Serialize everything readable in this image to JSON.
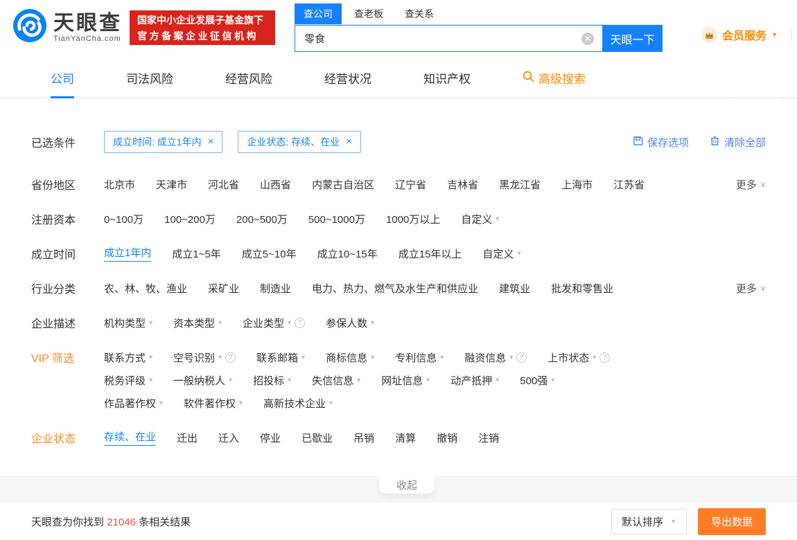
{
  "brand": {
    "name": "天眼查",
    "domain": "TianYanCha.com",
    "badge_line1": "国家中小企业发展子基金旗下",
    "badge_line2": "官方备案企业征信机构"
  },
  "colors": {
    "primary_blue": "#1681fd",
    "link_blue": "#4a87e9",
    "orange": "#ff8a2b",
    "badge_red": "#d9241b",
    "count_red": "#f34c3f",
    "export_orange": "#ff7d27"
  },
  "search": {
    "tabs": [
      {
        "label": "查公司",
        "active": true
      },
      {
        "label": "查老板",
        "active": false
      },
      {
        "label": "查关系",
        "active": false
      }
    ],
    "value": "零食",
    "button_label": "天眼一下"
  },
  "member": {
    "label": "会员服务"
  },
  "nav": {
    "items": [
      {
        "label": "公司",
        "active": true
      },
      {
        "label": "司法风险",
        "active": false
      },
      {
        "label": "经营风险",
        "active": false
      },
      {
        "label": "经营状况",
        "active": false
      },
      {
        "label": "知识产权",
        "active": false
      }
    ],
    "advanced_label": "高级搜索"
  },
  "selected_bar": {
    "label": "已选条件",
    "chips": [
      "成立时间: 成立1年内",
      "企业状态: 存续、在业"
    ],
    "save_label": "保存选项",
    "clear_label": "清除全部"
  },
  "filter_rows": [
    {
      "label": "省份地区",
      "more": "更多",
      "lines": [
        [
          {
            "text": "北京市"
          },
          {
            "text": "天津市"
          },
          {
            "text": "河北省"
          },
          {
            "text": "山西省"
          },
          {
            "text": "内蒙古自治区"
          },
          {
            "text": "辽宁省"
          },
          {
            "text": "吉林省"
          },
          {
            "text": "黑龙江省"
          },
          {
            "text": "上海市"
          },
          {
            "text": "江苏省"
          }
        ]
      ]
    },
    {
      "label": "注册资本",
      "lines": [
        [
          {
            "text": "0~100万"
          },
          {
            "text": "100~200万"
          },
          {
            "text": "200~500万"
          },
          {
            "text": "500~1000万"
          },
          {
            "text": "1000万以上"
          },
          {
            "text": "自定义",
            "arrow": true
          }
        ]
      ]
    },
    {
      "label": "成立时间",
      "lines": [
        [
          {
            "text": "成立1年内",
            "selected": true
          },
          {
            "text": "成立1~5年"
          },
          {
            "text": "成立5~10年"
          },
          {
            "text": "成立10~15年"
          },
          {
            "text": "成立15年以上"
          },
          {
            "text": "自定义",
            "arrow": true
          }
        ]
      ]
    },
    {
      "label": "行业分类",
      "more": "更多",
      "lines": [
        [
          {
            "text": "农、林、牧、渔业"
          },
          {
            "text": "采矿业"
          },
          {
            "text": "制造业"
          },
          {
            "text": "电力、热力、燃气及水生产和供应业"
          },
          {
            "text": "建筑业"
          },
          {
            "text": "批发和零售业"
          }
        ]
      ]
    },
    {
      "label": "企业描述",
      "lines": [
        [
          {
            "text": "机构类型",
            "arrow": true
          },
          {
            "text": "资本类型",
            "arrow": true
          },
          {
            "text": "企业类型",
            "arrow": true,
            "help": true
          },
          {
            "text": "参保人数",
            "arrow": true
          }
        ]
      ]
    },
    {
      "label": "VIP 筛选",
      "orange": true,
      "lines": [
        [
          {
            "text": "联系方式",
            "arrow": true
          },
          {
            "text": "空号识别",
            "arrow": true,
            "help": true
          },
          {
            "text": "联系邮箱",
            "arrow": true
          },
          {
            "text": "商标信息",
            "arrow": true
          },
          {
            "text": "专利信息",
            "arrow": true
          },
          {
            "text": "融资信息",
            "arrow": true,
            "help": true
          },
          {
            "text": "上市状态",
            "arrow": true,
            "help": true
          }
        ],
        [
          {
            "text": "税务评级",
            "arrow": true
          },
          {
            "text": "一般纳税人",
            "arrow": true
          },
          {
            "text": "招投标",
            "arrow": true
          },
          {
            "text": "失信信息",
            "arrow": true
          },
          {
            "text": "网址信息",
            "arrow": true
          },
          {
            "text": "动产抵押",
            "arrow": true
          },
          {
            "text": "500强",
            "arrow": true
          }
        ],
        [
          {
            "text": "作品著作权",
            "arrow": true
          },
          {
            "text": "软件著作权",
            "arrow": true
          },
          {
            "text": "高新技术企业",
            "arrow": true
          }
        ]
      ]
    },
    {
      "label": "企业状态",
      "orange": true,
      "lines": [
        [
          {
            "text": "存续、在业",
            "selected": true
          },
          {
            "text": "迁出"
          },
          {
            "text": "迁入"
          },
          {
            "text": "停业"
          },
          {
            "text": "已歇业"
          },
          {
            "text": "吊销"
          },
          {
            "text": "清算"
          },
          {
            "text": "撤销"
          },
          {
            "text": "注销"
          }
        ]
      ]
    }
  ],
  "collapse_label": "收起",
  "results_bar": {
    "prefix": "天眼查为你找到",
    "count": "21046",
    "suffix": "条相关结果",
    "sort_label": "默认排序",
    "export_label": "导出数据"
  }
}
